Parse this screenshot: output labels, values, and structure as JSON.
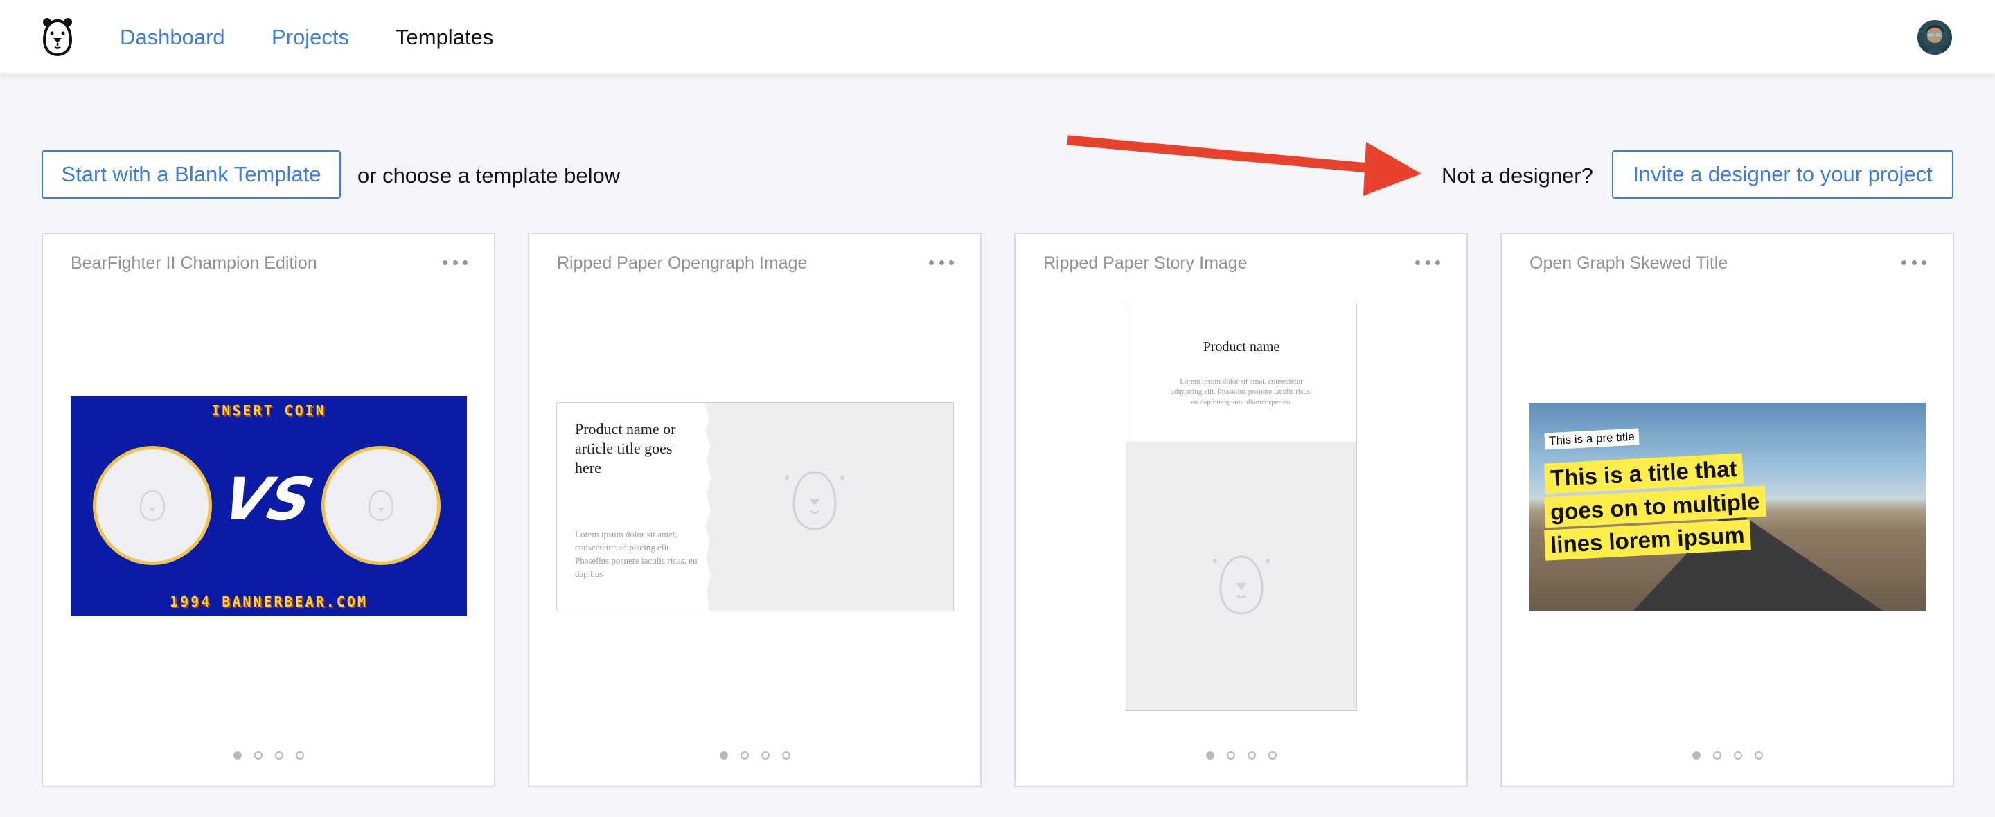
{
  "nav": {
    "items": [
      {
        "label": "Dashboard",
        "active": false
      },
      {
        "label": "Projects",
        "active": false
      },
      {
        "label": "Templates",
        "active": true
      }
    ]
  },
  "actions": {
    "blank_template_button": "Start with a Blank Template",
    "choose_text": "or choose a template below",
    "not_designer_text": "Not a designer?",
    "invite_button": "Invite a designer to your project"
  },
  "cards": [
    {
      "title": "BearFighter II Champion Edition",
      "preview": {
        "top_text": "INSERT COIN",
        "center_text": "VS",
        "bottom_text": "1994 BANNERBEAR.COM"
      },
      "dots": {
        "count": 4,
        "active_index": 0
      }
    },
    {
      "title": "Ripped Paper Opengraph Image",
      "preview": {
        "title": "Product name or article title goes here",
        "body": "Lorem ipsum dolor sit amet, consectetur adipiscing elit. Phasellus posuere iaculis risus, eu dapibus"
      },
      "dots": {
        "count": 4,
        "active_index": 0
      }
    },
    {
      "title": "Ripped Paper Story Image",
      "preview": {
        "title": "Product name",
        "body": "Lorem ipsum dolor sit amet, consectetur adipiscing elit. Phasellus posuere iaculis risus, eu dapibus quam ullamcorper eu."
      },
      "dots": {
        "count": 4,
        "active_index": 0
      }
    },
    {
      "title": "Open Graph Skewed Title",
      "preview": {
        "pretitle": "This is a pre title",
        "lines": [
          "This is a title that",
          "goes on to multiple",
          "lines lorem ipsum"
        ]
      },
      "dots": {
        "count": 4,
        "active_index": 0
      }
    }
  ],
  "colors": {
    "accent": "#3b7ddd",
    "arrow": "#e8412c",
    "background": "#f4f5f8",
    "arcade_blue": "#0a1ca6",
    "highlight_yellow": "#ffee4a"
  },
  "icons": [
    "bear-logo-icon",
    "user-avatar",
    "more-horizontal-icon",
    "arrow-annotation",
    "bear-placeholder-icon"
  ]
}
